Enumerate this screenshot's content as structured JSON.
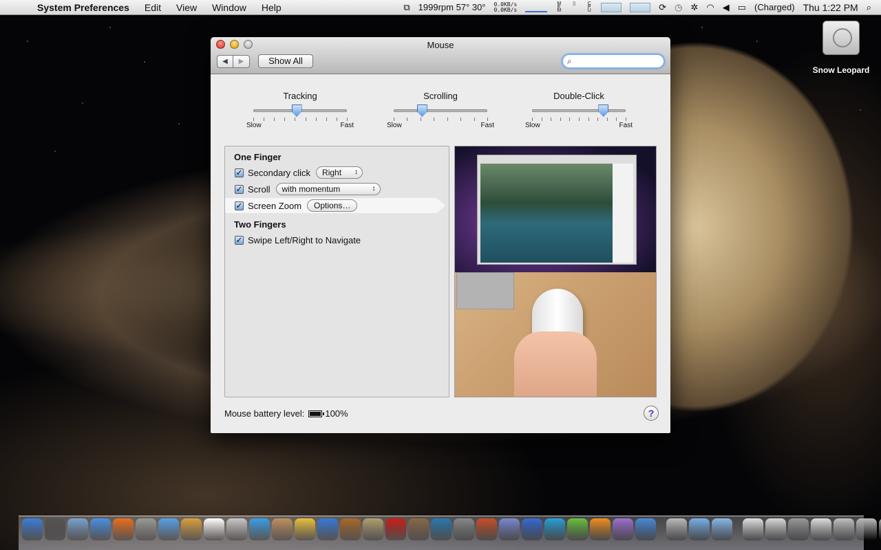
{
  "menubar": {
    "app_name": "System Preferences",
    "menus": [
      "Edit",
      "View",
      "Window",
      "Help"
    ],
    "fan_temp": "1999rpm 57° 30°",
    "net_up": "0.0KB/s",
    "net_down": "0.0KB/s",
    "battery_status": "(Charged)",
    "clock": "Thu 1:22 PM"
  },
  "desktop": {
    "drive_label": "Snow Leopard"
  },
  "window": {
    "title": "Mouse",
    "show_all_label": "Show All",
    "search_placeholder": "",
    "sliders": [
      {
        "label": "Tracking",
        "min_label": "Slow",
        "max_label": "Fast",
        "value": 0.46,
        "ticks": 10
      },
      {
        "label": "Scrolling",
        "min_label": "Slow",
        "max_label": "Fast",
        "value": 0.3,
        "ticks": 8
      },
      {
        "label": "Double-Click",
        "min_label": "Slow",
        "max_label": "Fast",
        "value": 0.76,
        "ticks": 11
      }
    ],
    "one_finger": {
      "title": "One Finger",
      "secondary_click_label": "Secondary click",
      "secondary_click_value": "Right",
      "scroll_label": "Scroll",
      "scroll_value": "with momentum",
      "screen_zoom_label": "Screen Zoom",
      "screen_zoom_button": "Options…"
    },
    "two_fingers": {
      "title": "Two Fingers",
      "swipe_label": "Swipe Left/Right to Navigate"
    },
    "battery_label": "Mouse battery level:",
    "battery_value": "100%",
    "help_label": "?"
  },
  "dock": {
    "colors": [
      "#3d7fd9",
      "#555",
      "#7aa3d0",
      "#4a90e2",
      "#e8701f",
      "#9a9a9a",
      "#5aa0e8",
      "#d9a040",
      "#ffffff",
      "#c8c8c8",
      "#3a9ee8",
      "#c09060",
      "#e8c040",
      "#3a7ad8",
      "#a86a2a",
      "#b0a070",
      "#c8201a",
      "#8a6a4a",
      "#2a7ab0",
      "#888",
      "#c8502a",
      "#7a8ad0",
      "#3a6ad0",
      "#2aa0d8",
      "#6ac040",
      "#f09020",
      "#a070d0",
      "#4a8ad8",
      "#bbb",
      "#7ab0e8",
      "#8ab8e8",
      "#e0e0e0",
      "#d8d8d8",
      "#999",
      "#ddd",
      "#c0c0c0",
      "#bbb",
      "#aaa"
    ]
  }
}
